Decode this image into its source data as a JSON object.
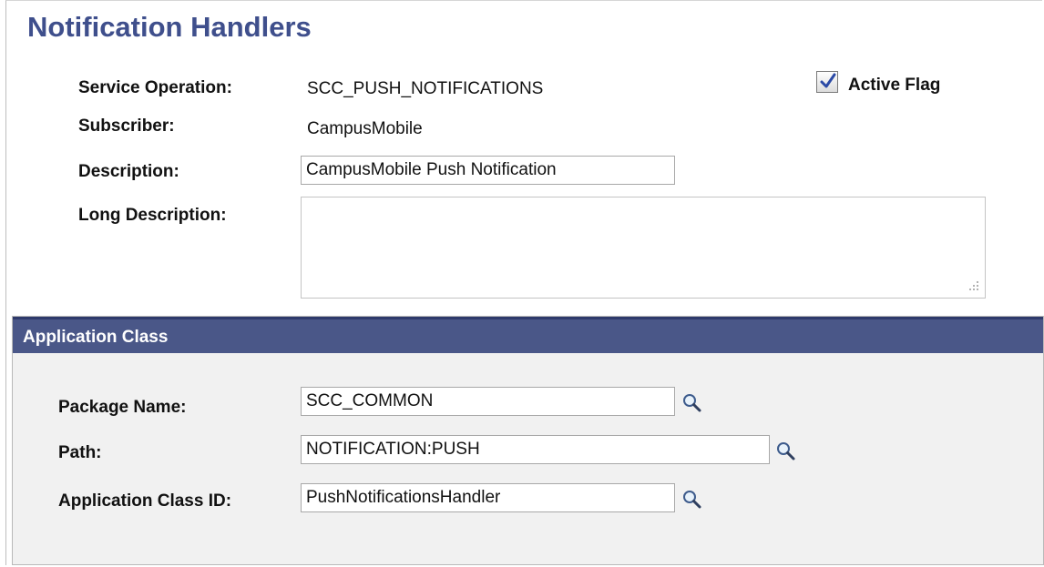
{
  "page": {
    "title": "Notification Handlers"
  },
  "header": {
    "service_operation_label": "Service Operation:",
    "service_operation_value": "SCC_PUSH_NOTIFICATIONS",
    "subscriber_label": "Subscriber:",
    "subscriber_value": "CampusMobile",
    "active_flag_label": "Active Flag",
    "active_flag_checked": true,
    "description_label": "Description:",
    "description_value": "CampusMobile Push Notification",
    "long_description_label": "Long Description:",
    "long_description_value": ""
  },
  "application_class": {
    "title": "Application Class",
    "package_name_label": "Package Name:",
    "package_name_value": "SCC_COMMON",
    "path_label": "Path:",
    "path_value": "NOTIFICATION:PUSH",
    "class_id_label": "Application Class ID:",
    "class_id_value": "PushNotificationsHandler"
  },
  "icons": {
    "lookup": "magnifier-lookup-icon",
    "checkbox": "checkmark-icon",
    "resize": "resize-grip-icon"
  },
  "colors": {
    "title": "#3f4f8c",
    "section_header": "#4a5788",
    "section_body": "#f1f1f1"
  }
}
